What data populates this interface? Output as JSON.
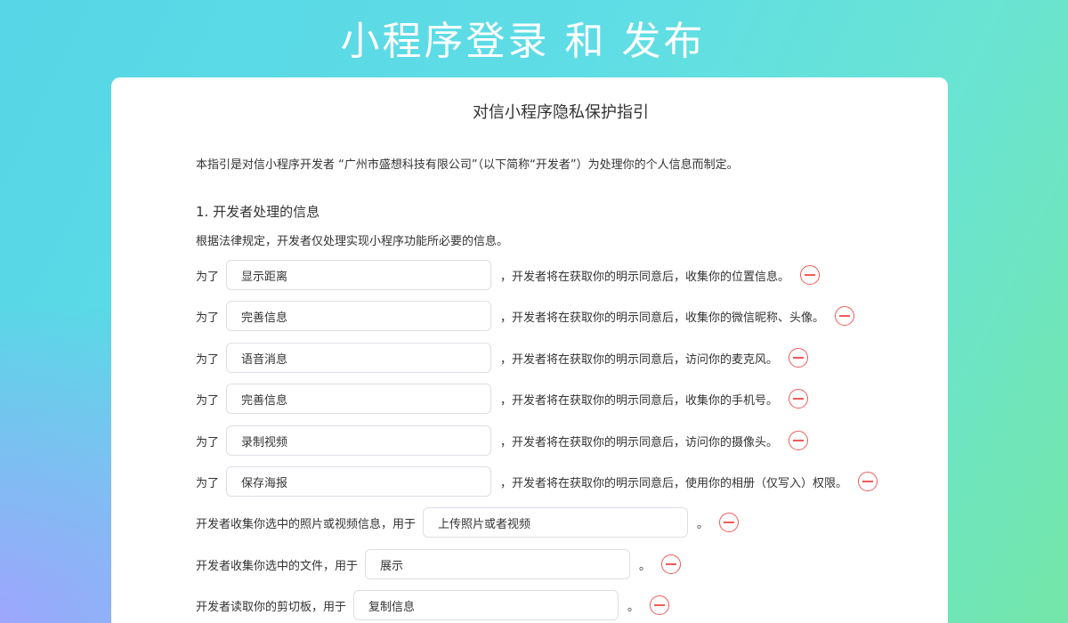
{
  "header": {
    "title": "小程序登录 和 发布"
  },
  "document": {
    "title": "对信小程序隐私保护指引",
    "intro": "本指引是对信小程序开发者 “广州市盛想科技有限公司”（以下简称“开发者”）为处理你的个人信息而制定。",
    "section1": {
      "title": "1.  开发者处理的信息",
      "description": "根据法律规定，开发者仅处理实现小程序功能所必要的信息。"
    },
    "purpose_rows": [
      {
        "prefix": "为了",
        "value": "显示距离",
        "suffix": "，开发者将在获取你的明示同意后，收集你的位置信息。"
      },
      {
        "prefix": "为了",
        "value": "完善信息",
        "suffix": "，开发者将在获取你的明示同意后，收集你的微信昵称、头像。"
      },
      {
        "prefix": "为了",
        "value": "语音消息",
        "suffix": "，开发者将在获取你的明示同意后，访问你的麦克风。"
      },
      {
        "prefix": "为了",
        "value": "完善信息",
        "suffix": "，开发者将在获取你的明示同意后，收集你的手机号。"
      },
      {
        "prefix": "为了",
        "value": "录制视频",
        "suffix": "，开发者将在获取你的明示同意后，访问你的摄像头。"
      },
      {
        "prefix": "为了",
        "value": "保存海报",
        "suffix": "，开发者将在获取你的明示同意后，使用你的相册（仅写入）权限。"
      }
    ],
    "usage_rows": [
      {
        "prefix": "开发者收集你选中的照片或视频信息，用于",
        "value": "上传照片或者视频",
        "suffix": "。"
      },
      {
        "prefix": "开发者收集你选中的文件，用于",
        "value": "展示",
        "suffix": "。"
      },
      {
        "prefix": "开发者读取你的剪切板，用于",
        "value": "复制信息",
        "suffix": "。"
      }
    ]
  },
  "icons": {
    "remove": "minus-circle-icon"
  },
  "colors": {
    "accent_remove": "#f25a58",
    "card_background": "#ffffff",
    "title_text": "#ffffff"
  }
}
